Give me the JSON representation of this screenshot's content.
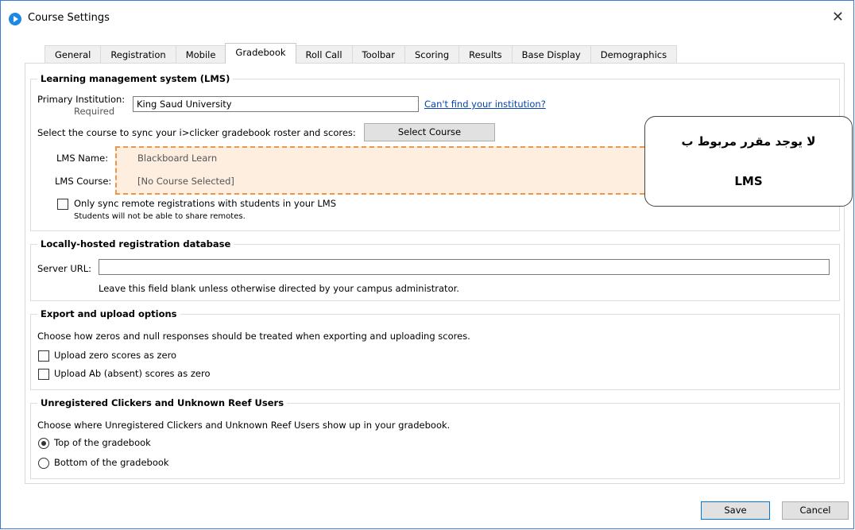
{
  "window": {
    "title": "Course Settings",
    "app_icon": "iclicker-logo-icon",
    "close_icon": "close-icon"
  },
  "tabs": [
    {
      "label": "General",
      "active": false
    },
    {
      "label": "Registration",
      "active": false
    },
    {
      "label": "Mobile",
      "active": false
    },
    {
      "label": "Gradebook",
      "active": true
    },
    {
      "label": "Roll Call",
      "active": false
    },
    {
      "label": "Toolbar",
      "active": false
    },
    {
      "label": "Scoring",
      "active": false
    },
    {
      "label": "Results",
      "active": false
    },
    {
      "label": "Base Display",
      "active": false
    },
    {
      "label": "Demographics",
      "active": false
    }
  ],
  "lms": {
    "legend": "Learning management system (LMS)",
    "primary_institution_label": "Primary Institution:",
    "required_label": "Required",
    "institution_value": "King Saud University",
    "cant_find_link": "Can't find your institution?",
    "select_course_prompt": "Select the course to sync your i>clicker gradebook roster and scores:",
    "select_course_button": "Select Course",
    "lms_name_label": "LMS Name:",
    "lms_name_value": "Blackboard Learn",
    "lms_course_label": "LMS Course:",
    "lms_course_value": "[No Course Selected]",
    "only_sync_label": "Only sync remote registrations with students in your LMS",
    "only_sync_checked": false,
    "only_sync_note": "Students will not be able to share remotes."
  },
  "local_db": {
    "legend": "Locally-hosted registration database",
    "server_url_label": "Server URL:",
    "server_url_value": "",
    "hint": "Leave this field blank unless otherwise directed by your campus administrator."
  },
  "export": {
    "legend": "Export and upload options",
    "description": "Choose how zeros and null responses should be treated when exporting and uploading scores.",
    "upload_zero_label": "Upload zero scores as zero",
    "upload_zero_checked": false,
    "upload_ab_label": "Upload Ab (absent) scores as zero",
    "upload_ab_checked": false
  },
  "unregistered": {
    "legend": "Unregistered Clickers and Unknown Reef Users",
    "description": "Choose where Unregistered Clickers and Unknown Reef Users show up in your gradebook.",
    "top_label": "Top of the gradebook",
    "bottom_label": "Bottom of the gradebook",
    "selected": "top"
  },
  "footer": {
    "save_label": "Save",
    "cancel_label": "Cancel"
  },
  "annotation": {
    "line1": "لا يوجد مقرر مربوط ب",
    "line2": "LMS"
  },
  "colors": {
    "highlight_fill": "#fdeee0",
    "highlight_border": "#f0964a",
    "link": "#0645ad",
    "window_border": "#3a7bd5"
  }
}
